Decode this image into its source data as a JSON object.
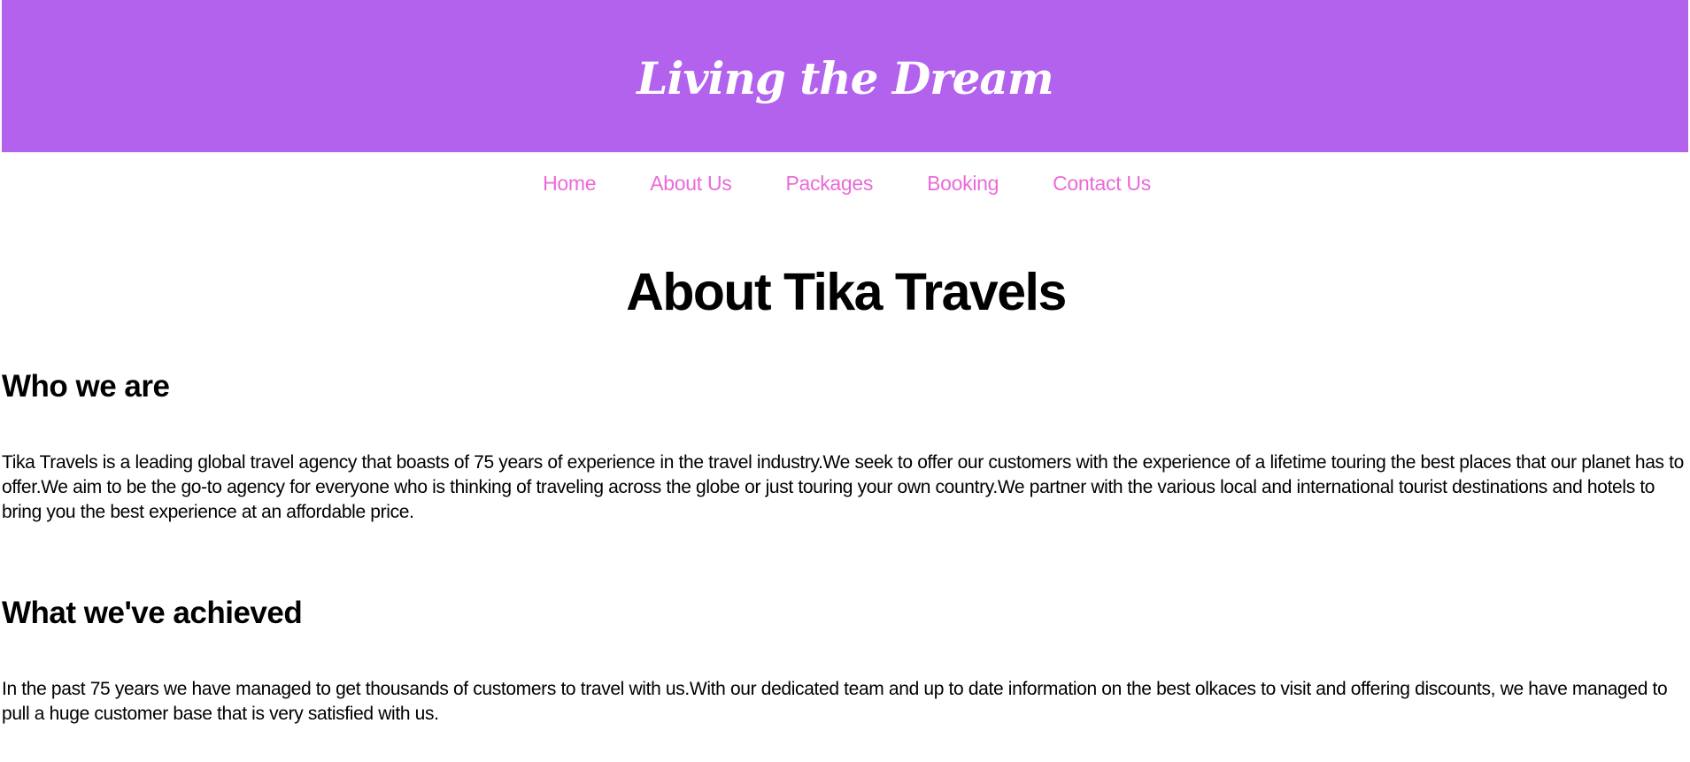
{
  "header": {
    "site_title": "Living the Dream"
  },
  "nav": {
    "items": [
      {
        "label": "Home"
      },
      {
        "label": "About Us"
      },
      {
        "label": "Packages"
      },
      {
        "label": "Booking"
      },
      {
        "label": "Contact Us"
      }
    ]
  },
  "main": {
    "page_title": "About Tika Travels",
    "sections": [
      {
        "heading": "Who we are",
        "body": "Tika Travels is a leading global travel agency that boasts of 75 years of experience in the travel industry.We seek to offer our customers with the experience of a lifetime touring the best places that our planet has to offer.We aim to be the go-to agency for everyone who is thinking of traveling across the globe or just touring your own country.We partner with the various local and international tourist destinations and hotels to bring you the best experience at an affordable price."
      },
      {
        "heading": "What we've achieved",
        "body": "In the past 75 years we have managed to get thousands of customers to travel with us.With our dedicated team and up to date information on the best olkaces to visit and offering discounts, we have managed to pull a huge customer base that is very satisfied with us."
      }
    ]
  },
  "colors": {
    "header_bg": "#b262ec",
    "nav_link": "#ea6ad8",
    "title_text": "#ffffff",
    "body_text": "#000000"
  }
}
